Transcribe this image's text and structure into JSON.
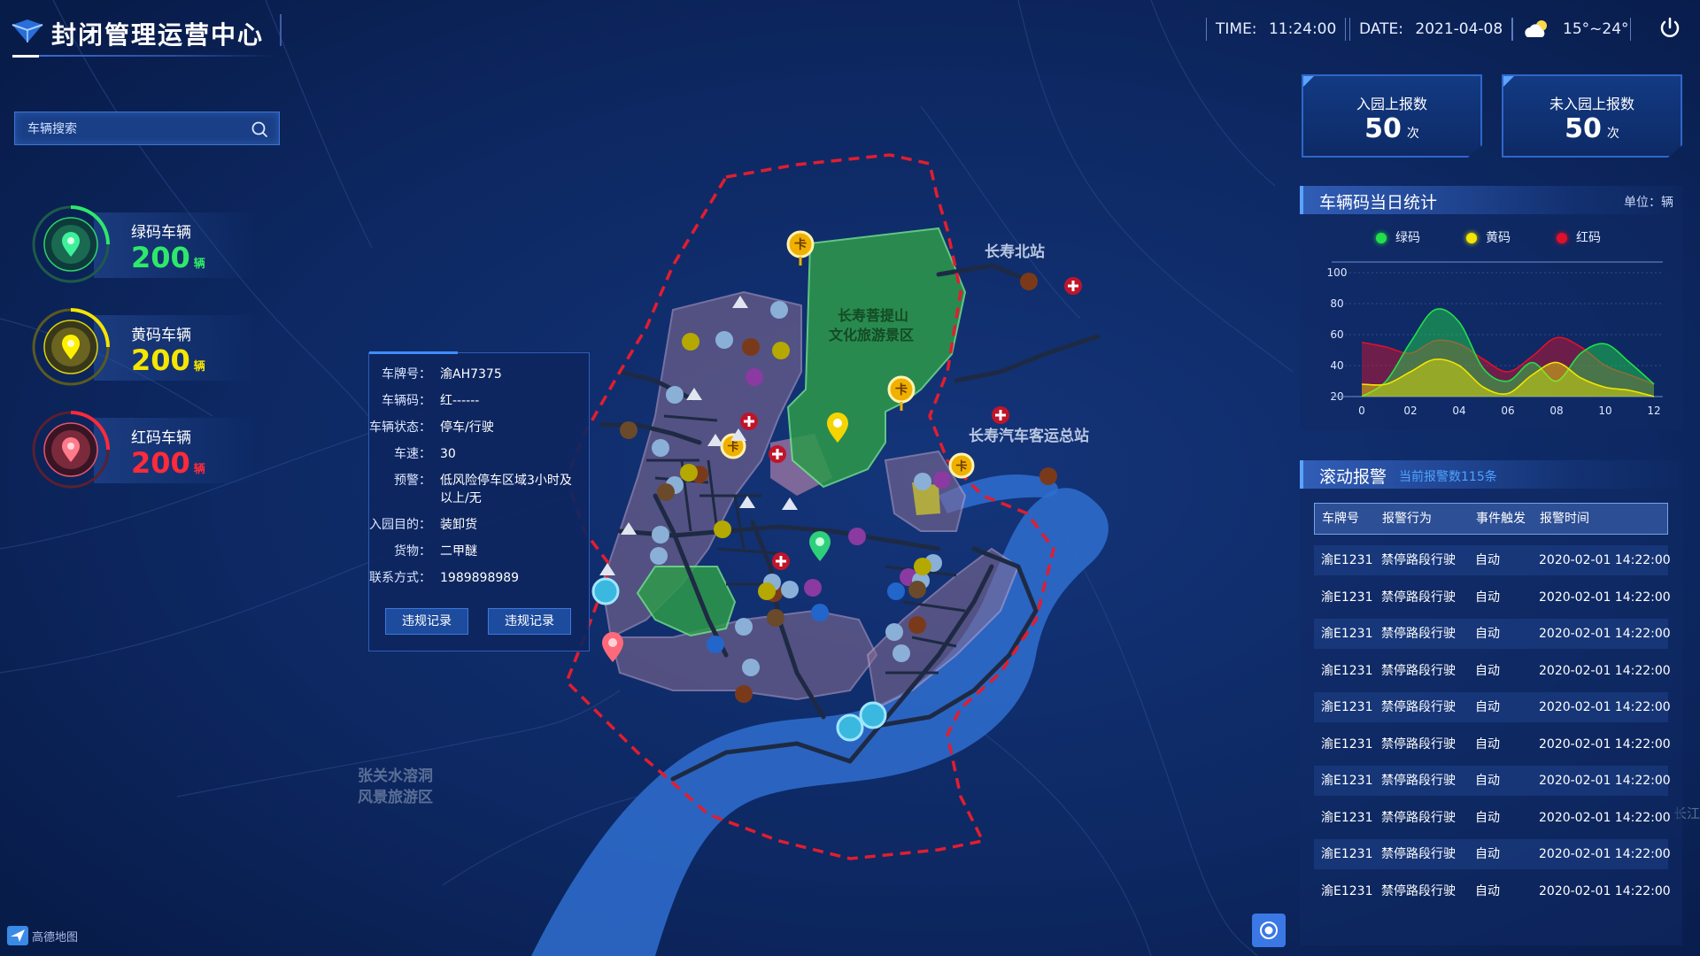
{
  "header": {
    "title": "封闭管理运营中心",
    "time_label": "TIME:",
    "time": "11:24:00",
    "date_label": "DATE:",
    "date": "2021-04-08",
    "weather_icon": "partly-cloudy-icon",
    "temperature": "15°~24°",
    "power_icon": "power-icon"
  },
  "search": {
    "placeholder": "车辆搜索",
    "icon": "search-icon"
  },
  "vehicle_stats": [
    {
      "label": "绿码车辆",
      "value": "200",
      "unit": "辆",
      "color": "#2ee86a"
    },
    {
      "label": "黄码车辆",
      "value": "200",
      "unit": "辆",
      "color": "#f5e500"
    },
    {
      "label": "红码车辆",
      "value": "200",
      "unit": "辆",
      "color": "#ff2a3a"
    }
  ],
  "popup": {
    "rows": [
      {
        "key": "车牌号：",
        "value": "渝AH7375"
      },
      {
        "key": "车辆码：",
        "value": "红------"
      },
      {
        "key": "车辆状态：",
        "value": "停车/行驶"
      },
      {
        "key": "车速：",
        "value": "30"
      },
      {
        "key": "预警：",
        "value": "低风险停车区域3小时及以上/无"
      },
      {
        "key": "入园目的：",
        "value": "装卸货"
      },
      {
        "key": "货物：",
        "value": "二甲醚"
      },
      {
        "key": "联系方式：",
        "value": "1989898989"
      }
    ],
    "buttons": [
      "违规记录",
      "违规记录"
    ]
  },
  "map": {
    "labels": {
      "scenic": "长寿菩提山\n文化旅游景区",
      "north_station": "长寿北站",
      "bus_station": "长寿汽车客运总站",
      "zhangguan": "张关水溶洞\n风景旅游区",
      "edge": "长江"
    },
    "colors": {
      "boundary": "#e21d2f",
      "river": "#2f6fd0",
      "green_zone": "#2e9a4a",
      "district": "#7a6a9a"
    }
  },
  "count_cards": [
    {
      "label": "入园上报数",
      "value": "50",
      "unit": "次"
    },
    {
      "label": "未入园上报数",
      "value": "50",
      "unit": "次"
    }
  ],
  "daily_stats": {
    "title": "车辆码当日统计",
    "unit": "单位：辆",
    "legend": [
      {
        "name": "绿码",
        "color": "#22e04a"
      },
      {
        "name": "黄码",
        "color": "#f2e600"
      },
      {
        "name": "红码",
        "color": "#e0102a"
      }
    ]
  },
  "chart_data": {
    "type": "area",
    "x": [
      0,
      1,
      2,
      3,
      4,
      5,
      6,
      7,
      8,
      9,
      10,
      11,
      12
    ],
    "xticks": [
      "0",
      "02",
      "04",
      "06",
      "08",
      "10",
      "12"
    ],
    "ylim": [
      20,
      100
    ],
    "yticks": [
      20,
      40,
      60,
      80,
      100
    ],
    "series": [
      {
        "name": "绿码",
        "color": "#22e04a",
        "values": [
          20,
          30,
          55,
          76,
          68,
          38,
          30,
          42,
          30,
          48,
          54,
          42,
          28
        ]
      },
      {
        "name": "黄码",
        "color": "#f2e600",
        "values": [
          28,
          28,
          36,
          44,
          40,
          26,
          22,
          34,
          42,
          32,
          26,
          24,
          20
        ]
      },
      {
        "name": "红码",
        "color": "#e0102a",
        "values": [
          55,
          52,
          48,
          56,
          54,
          44,
          36,
          46,
          58,
          52,
          40,
          34,
          28
        ]
      }
    ],
    "grid": true
  },
  "alarm": {
    "title": "滚动报警",
    "subtitle": "当前报警数115条",
    "columns": [
      "车牌号",
      "报警行为",
      "事件触发",
      "报警时间"
    ],
    "rows": [
      [
        "渝E1231",
        "禁停路段行驶",
        "自动",
        "2020-02-01 14:22:00"
      ],
      [
        "渝E1231",
        "禁停路段行驶",
        "自动",
        "2020-02-01 14:22:00"
      ],
      [
        "渝E1231",
        "禁停路段行驶",
        "自动",
        "2020-02-01 14:22:00"
      ],
      [
        "渝E1231",
        "禁停路段行驶",
        "自动",
        "2020-02-01 14:22:00"
      ],
      [
        "渝E1231",
        "禁停路段行驶",
        "自动",
        "2020-02-01 14:22:00"
      ],
      [
        "渝E1231",
        "禁停路段行驶",
        "自动",
        "2020-02-01 14:22:00"
      ],
      [
        "渝E1231",
        "禁停路段行驶",
        "自动",
        "2020-02-01 14:22:00"
      ],
      [
        "渝E1231",
        "禁停路段行驶",
        "自动",
        "2020-02-01 14:22:00"
      ],
      [
        "渝E1231",
        "禁停路段行驶",
        "自动",
        "2020-02-01 14:22:00"
      ],
      [
        "渝E1231",
        "禁停路段行驶",
        "自动",
        "2020-02-01 14:22:00"
      ]
    ]
  },
  "footer": {
    "map_brand": "高德地图"
  }
}
